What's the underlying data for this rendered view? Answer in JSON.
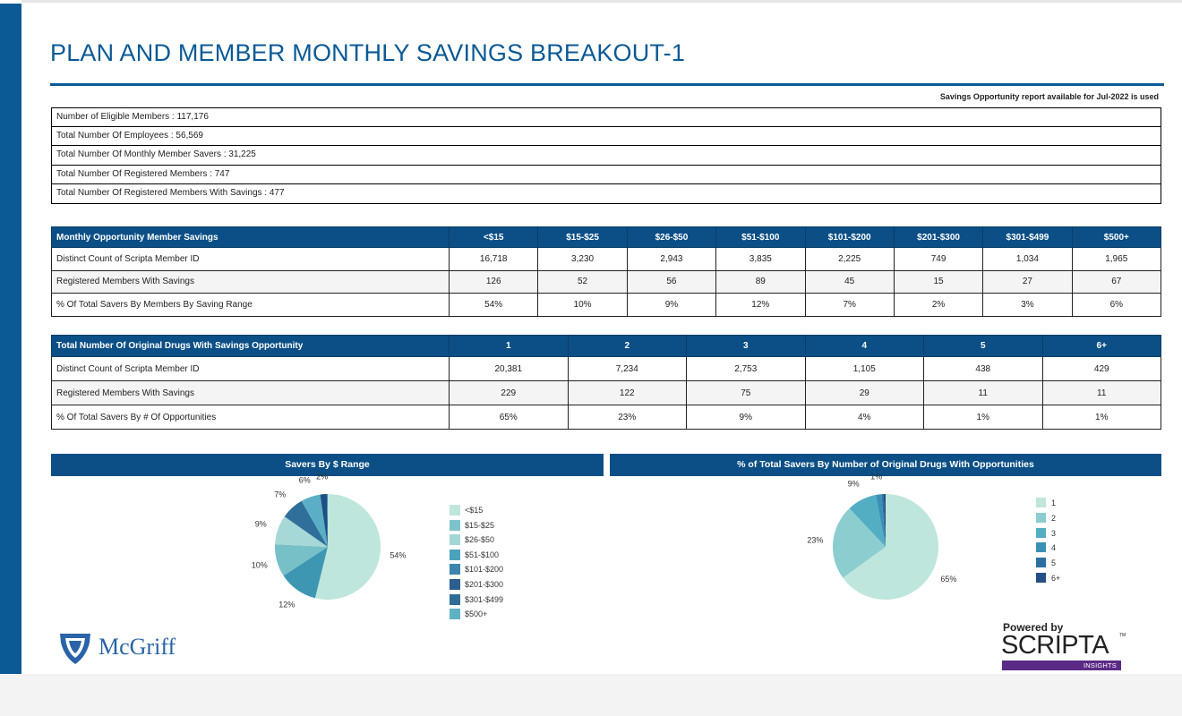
{
  "page": {
    "title": "PLAN AND MEMBER MONTHLY SAVINGS BREAKOUT-1",
    "subnote": "Savings Opportunity report available for Jul-2022 is used",
    "brand_color": "#0b5a96"
  },
  "summary": [
    "Number of Eligible Members : 117,176",
    "Total Number Of Employees : 56,569",
    "Total Number Of Monthly Member Savers : 31,225",
    "Total Number Of Registered Members : 747",
    "Total Number Of Registered Members With Savings : 477"
  ],
  "table1": {
    "header": "Monthly Opportunity Member Savings",
    "columns": [
      "<$15",
      "$15-$25",
      "$26-$50",
      "$51-$100",
      "$101-$200",
      "$201-$300",
      "$301-$499",
      "$500+"
    ],
    "rows": [
      {
        "label": "Distinct Count of Scripta Member ID",
        "values": [
          "16,718",
          "3,230",
          "2,943",
          "3,835",
          "2,225",
          "749",
          "1,034",
          "1,965"
        ]
      },
      {
        "label": "Registered Members With Savings",
        "values": [
          "126",
          "52",
          "56",
          "89",
          "45",
          "15",
          "27",
          "67"
        ]
      },
      {
        "label": "% Of Total Savers By Members By Saving Range",
        "values": [
          "54%",
          "10%",
          "9%",
          "12%",
          "7%",
          "2%",
          "3%",
          "6%"
        ]
      }
    ]
  },
  "table2": {
    "header": "Total Number Of Original Drugs With Savings Opportunity",
    "columns": [
      "1",
      "2",
      "3",
      "4",
      "5",
      "6+"
    ],
    "rows": [
      {
        "label": "Distinct Count of Scripta Member ID",
        "values": [
          "20,381",
          "7,234",
          "2,753",
          "1,105",
          "438",
          "429"
        ]
      },
      {
        "label": "Registered Members With Savings",
        "values": [
          "229",
          "122",
          "75",
          "29",
          "11",
          "11"
        ]
      },
      {
        "label": "% Of Total Savers By # Of Opportunities",
        "values": [
          "65%",
          "23%",
          "9%",
          "4%",
          "1%",
          "1%"
        ]
      }
    ]
  },
  "chart_data": [
    {
      "type": "pie",
      "title": "Savers By $ Range",
      "categories": [
        "<$15",
        "$15-$25",
        "$26-$50",
        "$51-$100",
        "$101-$200",
        "$201-$300",
        "$301-$499",
        "$500+"
      ],
      "values": [
        54,
        12,
        10,
        9,
        7,
        6,
        2,
        0.3
      ],
      "slice_labels": [
        "54%",
        "12%",
        "10%",
        "9%",
        "7%",
        "6%",
        "2%",
        ""
      ],
      "colors": [
        "#bfe6dc",
        "#3d97b2",
        "#78c0c8",
        "#a7d8d8",
        "#2f6f99",
        "#5aaec5",
        "#1e4f83",
        "#3a86ad"
      ],
      "legend": {
        "labels": [
          "<$15",
          "$15-$25",
          "$26-$50",
          "$51-$100",
          "$101-$200",
          "$201-$300",
          "$301-$499",
          "$500+"
        ],
        "colors": [
          "#bfe6dc",
          "#7cc4cb",
          "#a3d6d6",
          "#4aa3bd",
          "#3b86ad",
          "#2b5f8f",
          "#2e6b96",
          "#5fb1c6"
        ],
        "position": "right"
      }
    },
    {
      "type": "pie",
      "title": "% of Total Savers By Number of Original Drugs With Opportunities",
      "categories": [
        "1",
        "2",
        "3",
        "4",
        "5",
        "6+"
      ],
      "values": [
        65,
        23,
        9,
        1.8,
        0.6,
        0.6
      ],
      "slice_labels": [
        "65%",
        "23%",
        "9%",
        "1%",
        "",
        ""
      ],
      "colors": [
        "#bfe6dc",
        "#8ccdd0",
        "#53aec4",
        "#3b90b6",
        "#2a6fa1",
        "#244f86"
      ],
      "legend": {
        "labels": [
          "1",
          "2",
          "3",
          "4",
          "5",
          "6+"
        ],
        "colors": [
          "#bfe6dc",
          "#8ccdd0",
          "#53aec4",
          "#3b90b6",
          "#2a6fa1",
          "#244f86"
        ],
        "position": "right"
      }
    }
  ],
  "logos": {
    "mcgriff": "McGriff",
    "powered_by": "Powered by",
    "scripta": "SCRIPTA",
    "tm": "TM",
    "insights": "INSIGHTS"
  }
}
